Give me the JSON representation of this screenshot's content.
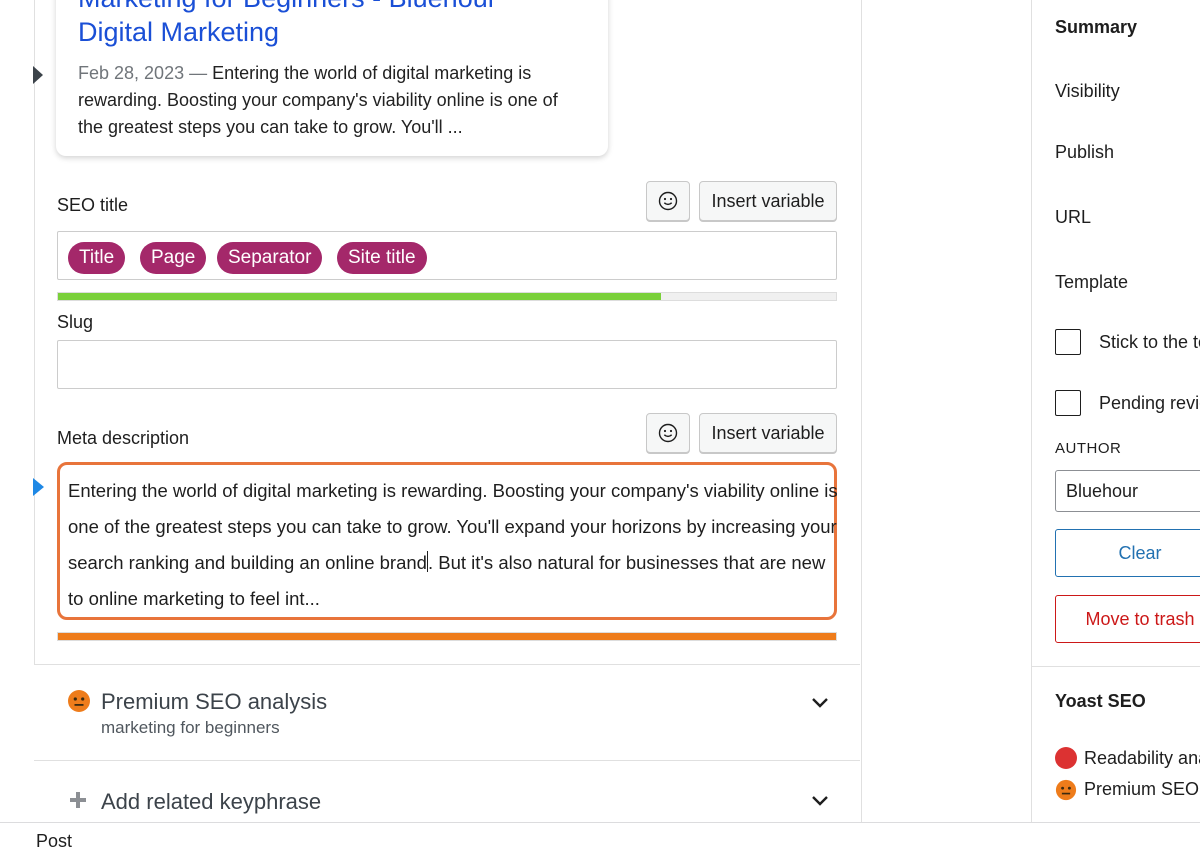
{
  "preview": {
    "title_line1": "Marketing for Beginners - Bluehour",
    "title_line2": "Digital Marketing",
    "date": "Feb 28, 2023",
    "dash": "—",
    "description": "Entering the world of digital marketing is rewarding. Boosting your company's viability online is one of the greatest steps you can take to grow. You'll ..."
  },
  "seo_title": {
    "label": "SEO title",
    "insert_variable": "Insert variable",
    "pills": [
      "Title",
      "Page",
      "Separator",
      "Site title"
    ],
    "progress_percent": 77.5,
    "progress_color": "#7ad03a"
  },
  "slug": {
    "label": "Slug",
    "value": ""
  },
  "meta_description": {
    "label": "Meta description",
    "insert_variable": "Insert variable",
    "text_before_caret": "Entering the world of digital marketing is rewarding. Boosting your company's viability online is one of the greatest steps you can take to grow. You'll expand your horizons by increasing your search ranking and building an online brand",
    "text_after_caret": ". But it's also natural for businesses that are new to online marketing to feel int...",
    "progress_percent": 100,
    "progress_color": "#ee7c1b",
    "border_color": "#e8743b"
  },
  "premium_seo": {
    "title": "Premium SEO analysis",
    "keyphrase": "marketing for beginners",
    "icon": "neutral-face-icon"
  },
  "related_keyphrase": {
    "title": "Add related keyphrase",
    "icon": "plus-icon"
  },
  "sidebar": {
    "summary": "Summary",
    "visibility": "Visibility",
    "publish": "Publish",
    "url": "URL",
    "template": "Template",
    "stick_to_top": "Stick to the top of the blog",
    "pending_review": "Pending review",
    "author_heading": "AUTHOR",
    "author_value": "Bluehour",
    "clear_button": "Clear",
    "move_button": "Move to trash",
    "yoast_heading": "Yoast SEO",
    "readability": "Readability analysis",
    "premium_seo": "Premium SEO analysis",
    "colors": {
      "link": "#2271b1",
      "danger": "#cc1818",
      "readability_dot": "#dc3232",
      "seo_dot": "#ee7c1b"
    }
  },
  "status_bar": {
    "breadcrumb": "Post"
  },
  "colors": {
    "pill": "#a4286a",
    "preview_link": "#1a4fd6"
  }
}
